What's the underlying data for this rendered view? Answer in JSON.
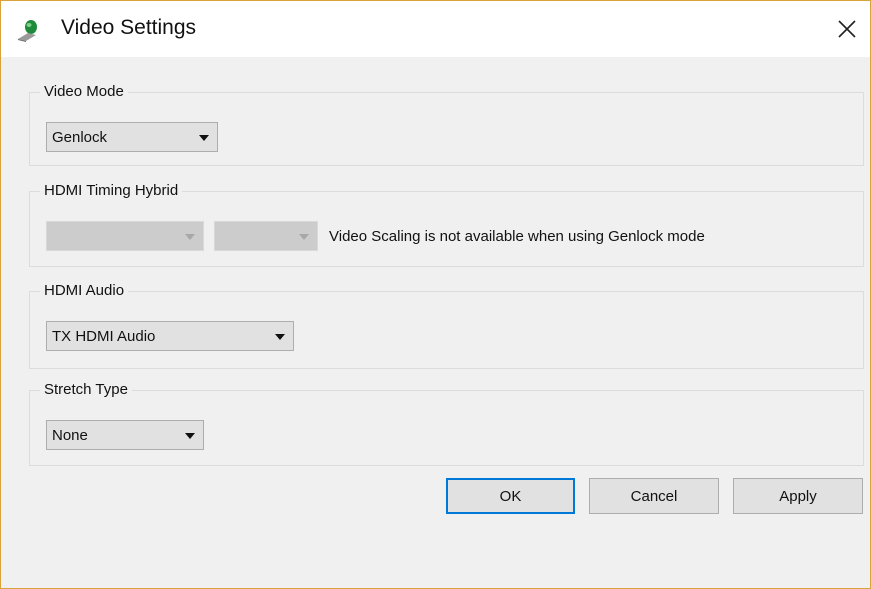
{
  "window": {
    "title": "Video Settings",
    "icon": "video-settings-app-icon",
    "close_glyph": "✕"
  },
  "video_mode": {
    "label": "Video Mode",
    "selected": "Genlock"
  },
  "hdmi_timing": {
    "label": "HDMI Timing Hybrid",
    "select1": "",
    "select2": "",
    "note": "Video Scaling is not available when using Genlock mode"
  },
  "hdmi_audio": {
    "label": "HDMI Audio",
    "selected": "TX HDMI Audio"
  },
  "stretch_type": {
    "label": "Stretch Type",
    "selected": "None"
  },
  "buttons": {
    "ok": "OK",
    "cancel": "Cancel",
    "apply": "Apply"
  },
  "colors": {
    "accent": "#0078d7",
    "background": "#f0f0f0"
  }
}
